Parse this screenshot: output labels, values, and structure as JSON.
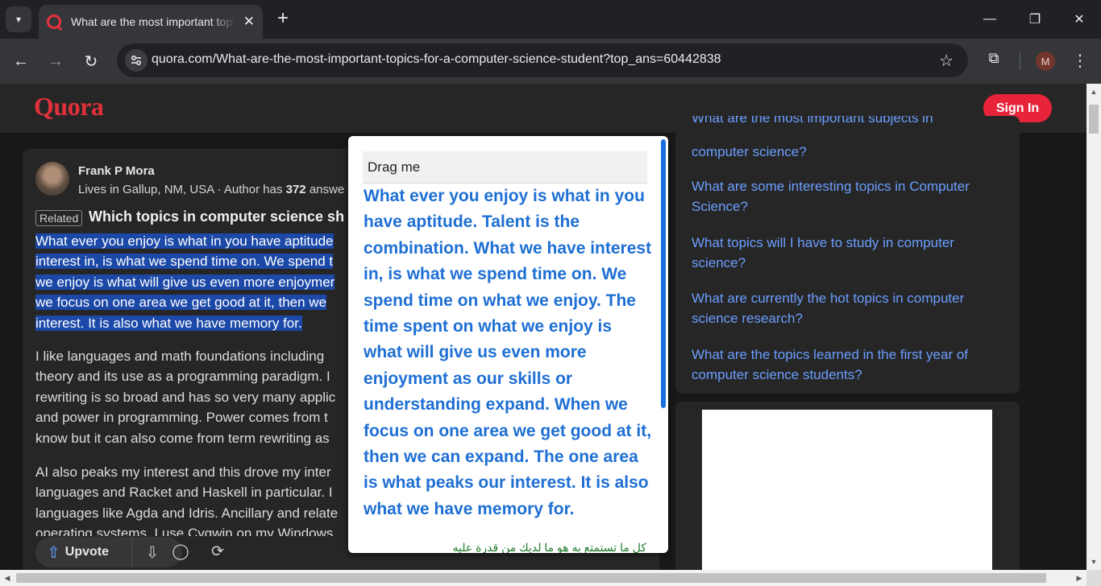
{
  "browser": {
    "tab_title": "What are the most important topics for a computer science student?",
    "url": "quora.com/What-are-the-most-important-topics-for-a-computer-science-student?top_ans=60442838",
    "profile_initial": "M",
    "icons": {
      "tab_search": "▾",
      "tab_close": "✕",
      "new_tab": "+",
      "minimize": "—",
      "restore": "❐",
      "close": "✕",
      "back": "←",
      "forward": "→",
      "reload": "↻",
      "site_info": "⚙",
      "bookmark": "☆",
      "extensions": "⧉",
      "menu": "⋮"
    }
  },
  "header": {
    "logo": "Quora",
    "signin_label": "Sign In"
  },
  "answer": {
    "author": "Frank P Mora",
    "credential_prefix": "Lives in Gallup, NM, USA · Author has ",
    "credential_count": "372",
    "credential_suffix": " answe",
    "related_badge": "Related",
    "related_question": "Which topics in computer science sh",
    "highlighted_lines": [
      "What ever you enjoy is what in you have aptitude",
      "interest in, is what we spend time on. We spend t",
      "we enjoy is what will give us even more enjoymer",
      "we focus on one area we get good at it, then we",
      "interest. It is also what we have memory for."
    ],
    "paragraph2_lines": [
      "I like languages and math foundations including",
      "theory and its use as a programming paradigm. I",
      "rewriting is so broad and has so very many applic",
      "and power in programming. Power comes from t",
      "know but it can also come from term rewriting as"
    ],
    "paragraph3_lines": [
      "AI also peaks my interest and this drove my inter",
      "languages and Racket and Haskell in particular. I",
      "languages like Agda and Idris. Ancillary and relate",
      "operating systems. I use Cygwin on my Windows"
    ]
  },
  "actions": {
    "upvote_label": "Upvote",
    "icons": {
      "upvote": "⇧",
      "downvote": "⇩",
      "comment": "◯",
      "share": "⟳"
    }
  },
  "related": {
    "partial_top": "What are the most important subjects in",
    "links": [
      "computer science?",
      "What are some interesting topics in Computer Science?",
      "What topics will I have to study in computer science?",
      "What are currently the hot topics in computer science research?",
      "What are the topics learned in the first year of computer science students?"
    ]
  },
  "popup": {
    "drag_label": "Drag me",
    "text": "What ever you enjoy is what in you have aptitude. Talent is the combination. What we have interest in, is what we spend time on. We spend time on what we enjoy. The time spent on what we enjoy is what will give us even more enjoyment as our skills or understanding expand. When we focus on one area we get good at it, then we can expand. The one area is what peaks our interest. It is also what we have memory for.",
    "footer_partial": "كل ما تستمتع به هو ما لديك من قدرة عليه"
  },
  "colors": {
    "quora_red": "#e0313b",
    "link_blue": "#6b9eff",
    "selection": "#1c49a8",
    "popup_text": "#1e6fd4"
  }
}
